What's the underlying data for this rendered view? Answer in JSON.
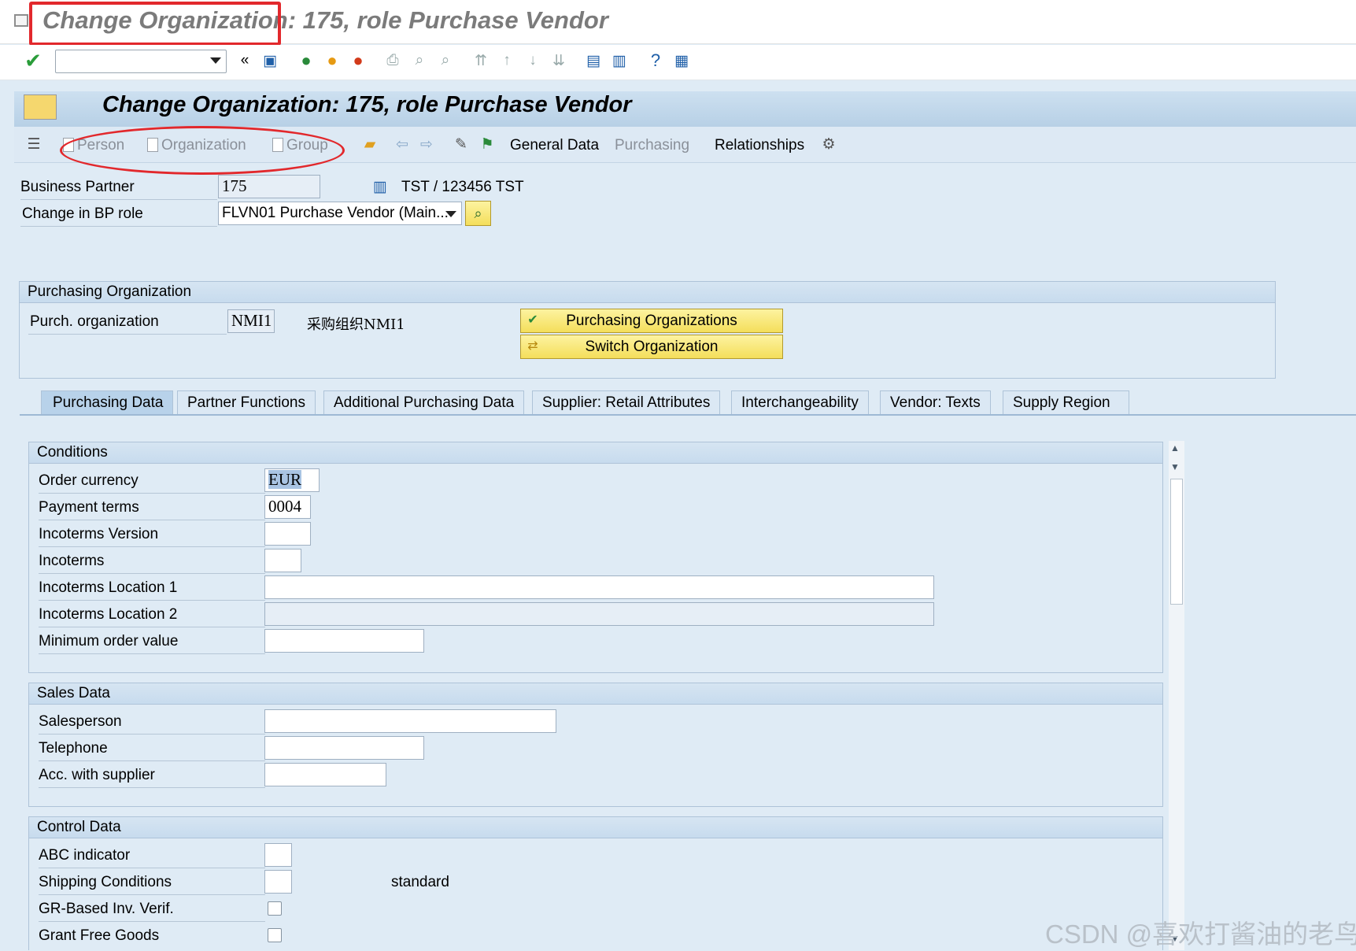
{
  "window": {
    "title": "Change Organization: 175, role Purchase Vendor"
  },
  "screen": {
    "title": "Change Organization: 175, role Purchase Vendor"
  },
  "app_toolbar": {
    "person": "Person",
    "organization": "Organization",
    "group": "Group",
    "general_data": "General Data",
    "purchasing": "Purchasing",
    "relationships": "Relationships"
  },
  "header": {
    "bp_label": "Business Partner",
    "bp_value": "175",
    "bp_desc": "TST / 123456 TST",
    "role_label": "Change in BP role",
    "role_value": "FLVN01 Purchase Vendor (Main..."
  },
  "purch_org": {
    "title": "Purchasing Organization",
    "label": "Purch. organization",
    "value": "NMI1",
    "desc": "采购组织NMI1",
    "btn_orgs": "Purchasing Organizations",
    "btn_switch": "Switch Organization"
  },
  "tabs": [
    "Purchasing Data",
    "Partner Functions",
    "Additional Purchasing Data",
    "Supplier: Retail Attributes",
    "Interchangeability",
    "Vendor: Texts",
    "Supply Region"
  ],
  "conditions": {
    "title": "Conditions",
    "order_currency": "Order currency",
    "order_currency_value": "EUR",
    "payment_terms": "Payment terms",
    "payment_terms_value": "0004",
    "incoterms_version": "Incoterms Version",
    "incoterms": "Incoterms",
    "incoterms_loc1": "Incoterms Location 1",
    "incoterms_loc2": "Incoterms Location 2",
    "min_order": "Minimum order value"
  },
  "sales": {
    "title": "Sales Data",
    "salesperson": "Salesperson",
    "telephone": "Telephone",
    "acc_supplier": "Acc. with supplier"
  },
  "control": {
    "title": "Control Data",
    "abc": "ABC indicator",
    "shipping": "Shipping Conditions",
    "shipping_desc": "standard",
    "gr_based": "GR-Based Inv. Verif.",
    "grant_free": "Grant Free Goods"
  },
  "watermark": "CSDN @喜欢打酱油的老鸟",
  "colors": {
    "highlight": "#e2282c",
    "button": "#f4de5b",
    "background": "#dfebf5"
  }
}
